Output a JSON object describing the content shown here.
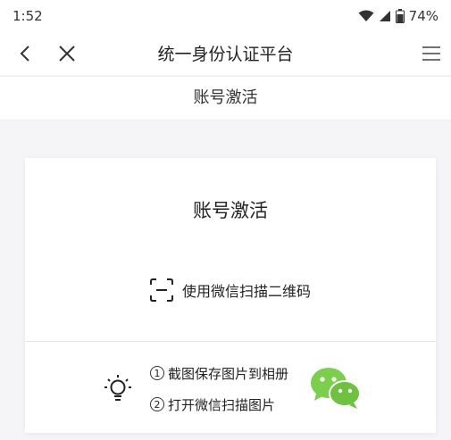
{
  "status_bar": {
    "time": "1:52",
    "battery": "74%",
    "icons": [
      "wifi-icon",
      "signal-icon",
      "battery-icon"
    ]
  },
  "nav": {
    "title": "统一身份认证平台",
    "icons": [
      "back-icon",
      "close-icon",
      "menu-icon"
    ]
  },
  "subheader": {
    "title": "账号激活"
  },
  "card": {
    "title": "账号激活",
    "scan_label": "使用微信扫描二维码",
    "steps": [
      {
        "num": "1",
        "text": "截图保存图片到相册"
      },
      {
        "num": "2",
        "text": "打开微信扫描图片"
      }
    ],
    "icons": [
      "scan-icon",
      "lightbulb-icon",
      "wechat-icon"
    ]
  },
  "colors": {
    "wechat_green": "#7bd04b",
    "background": "#f5f5f7"
  }
}
